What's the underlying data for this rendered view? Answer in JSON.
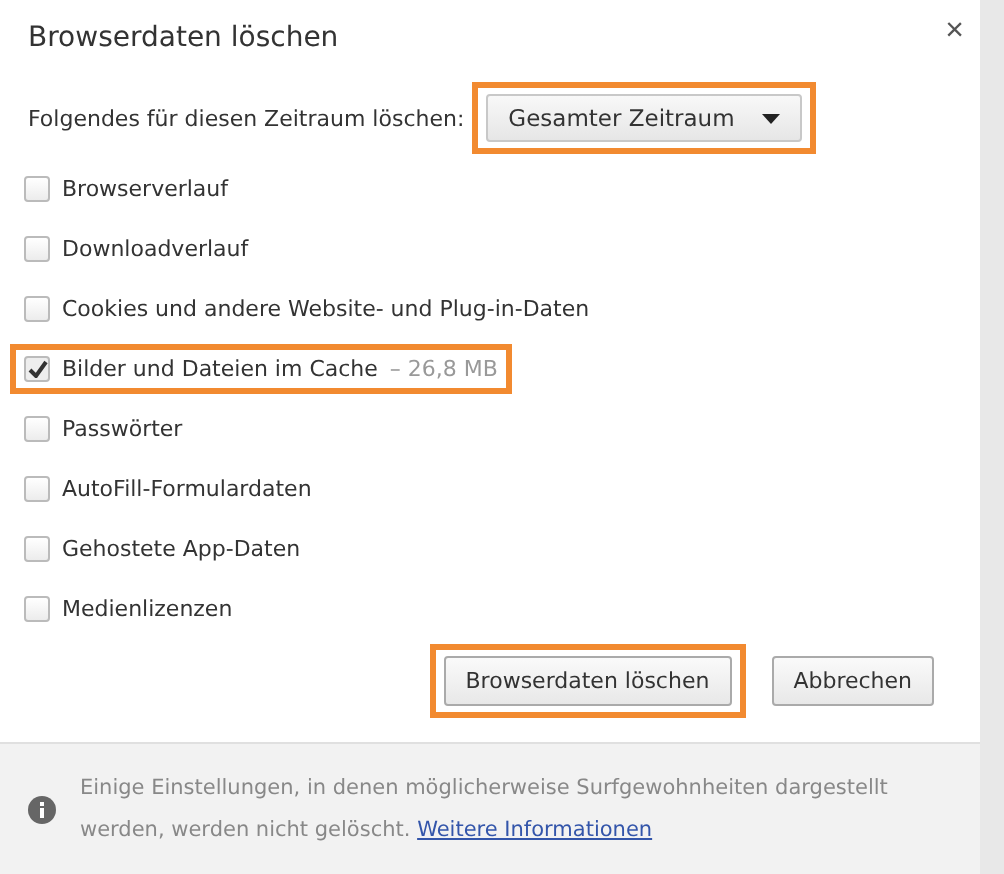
{
  "dialog": {
    "title": "Browserdaten löschen",
    "close": "×"
  },
  "range": {
    "label": "Folgendes für diesen Zeitraum löschen:",
    "value": "Gesamter Zeitraum",
    "highlighted": true
  },
  "items": [
    {
      "label": "Browserverlauf",
      "checked": false,
      "highlighted": false
    },
    {
      "label": "Downloadverlauf",
      "checked": false,
      "highlighted": false
    },
    {
      "label": "Cookies und andere Website- und Plug-in-Daten",
      "checked": false,
      "highlighted": false
    },
    {
      "label": "Bilder und Dateien im Cache",
      "size": "–  26,8 MB",
      "checked": true,
      "highlighted": true
    },
    {
      "label": "Passwörter",
      "checked": false,
      "highlighted": false
    },
    {
      "label": "AutoFill-Formulardaten",
      "checked": false,
      "highlighted": false
    },
    {
      "label": "Gehostete App-Daten",
      "checked": false,
      "highlighted": false
    },
    {
      "label": "Medienlizenzen",
      "checked": false,
      "highlighted": false
    }
  ],
  "buttons": [
    {
      "label": "Browserdaten löschen",
      "highlighted": true
    },
    {
      "label": "Abbrechen",
      "highlighted": false
    }
  ],
  "footer": {
    "text": "Einige Einstellungen, in denen möglicherweise Surfgewohnheiten dargestellt werden, werden nicht gelöscht.",
    "link": "Weitere Informationen"
  }
}
